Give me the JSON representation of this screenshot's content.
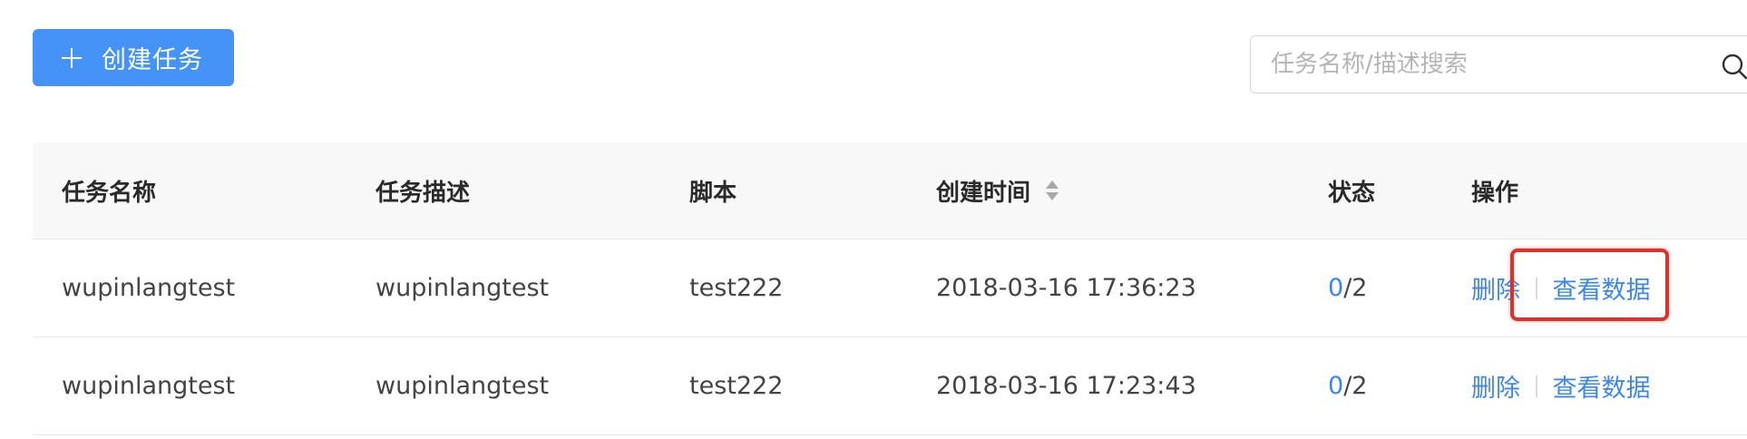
{
  "toolbar": {
    "create_label": "创建任务",
    "search_placeholder": "任务名称/描述搜索",
    "search_value": ""
  },
  "table": {
    "columns": [
      "任务名称",
      "任务描述",
      "脚本",
      "创建时间",
      "状态",
      "操作"
    ],
    "rows": [
      {
        "name": "wupinlangtest",
        "desc": "wupinlangtest",
        "script": "test222",
        "created": "2018-03-16 17:36:23",
        "status_done": "0",
        "status_total": "/2",
        "action_delete": "删除",
        "action_view": "查看数据"
      },
      {
        "name": "wupinlangtest",
        "desc": "wupinlangtest",
        "script": "test222",
        "created": "2018-03-16 17:23:43",
        "status_done": "0",
        "status_total": "/2",
        "action_delete": "删除",
        "action_view": "查看数据"
      }
    ]
  },
  "colors": {
    "primary": "#4593f6",
    "link": "#3d86f0",
    "highlight": "#d9342b"
  },
  "icons": {
    "create": "plus-icon",
    "search": "search-icon",
    "sort": "sort-icon"
  }
}
